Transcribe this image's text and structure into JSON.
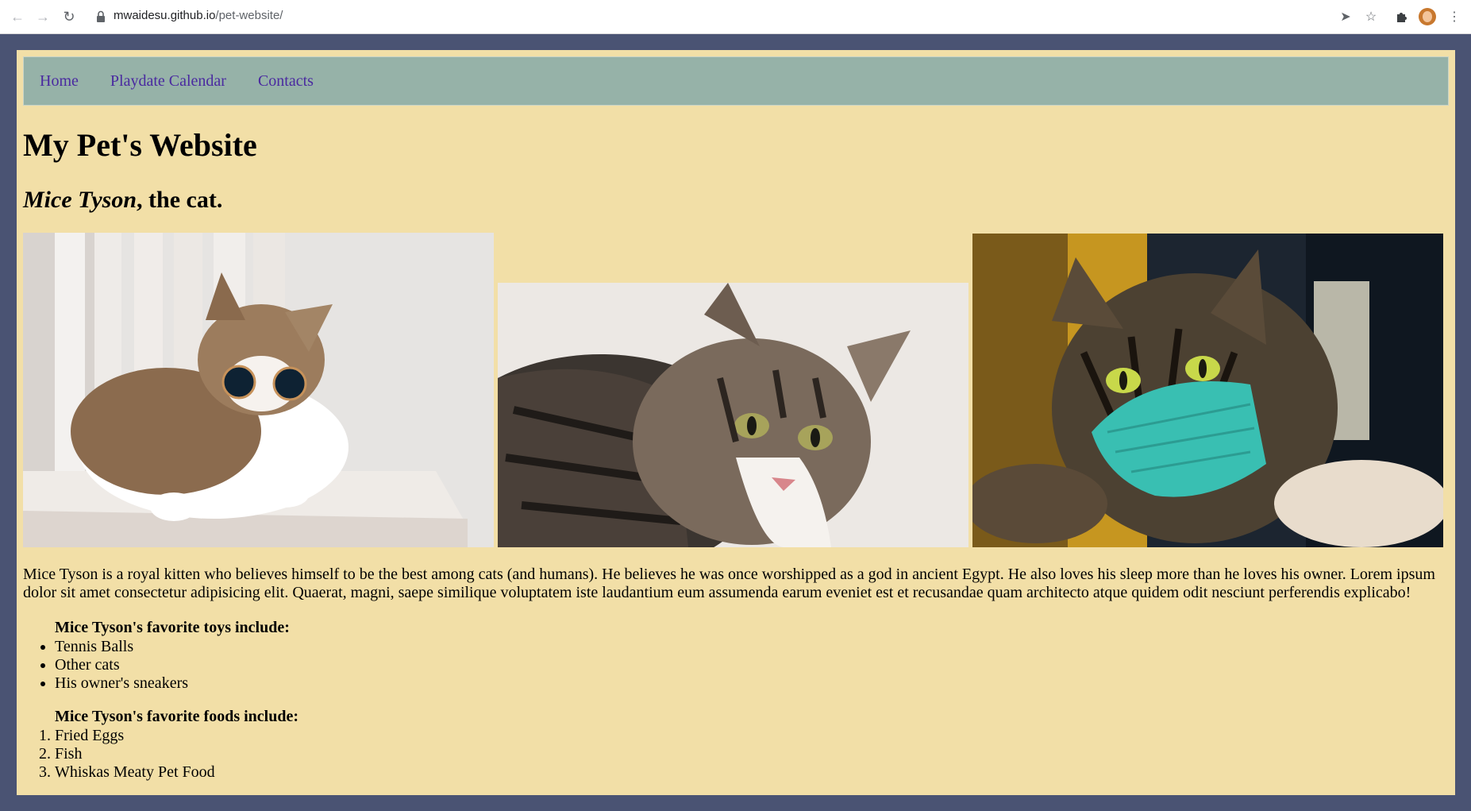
{
  "browser": {
    "url_host": "mwaidesu.github.io",
    "url_path": "/pet-website/"
  },
  "nav": {
    "items": [
      {
        "label": "Home"
      },
      {
        "label": "Playdate Calendar"
      },
      {
        "label": "Contacts"
      }
    ]
  },
  "page": {
    "title": "My Pet's Website",
    "subtitle_name": "Mice Tyson",
    "subtitle_rest": ", the cat.",
    "description": "Mice Tyson is a royal kitten who believes himself to be the best among cats (and humans). He believes he was once worshipped as a god in ancient Egypt. He also loves his sleep more than he loves his owner. Lorem ipsum dolor sit amet consectetur adipisicing elit. Quaerat, magni, saepe similique voluptatem iste laudantium eum assumenda earum eveniet est et recusandae quam architecto atque quidem odit nesciunt perferendis explicabo!"
  },
  "toys": {
    "title": "Mice Tyson's favorite toys include:",
    "items": [
      "Tennis Balls",
      "Other cats",
      "His owner's sneakers"
    ]
  },
  "foods": {
    "title": "Mice Tyson's favorite foods include:",
    "items": [
      "Fried Eggs",
      "Fish",
      "Whiskas Meaty Pet Food"
    ]
  },
  "colors": {
    "frame": "#4a5373",
    "page_bg": "#f2dfa7",
    "navbar_bg": "#96b2a8",
    "link": "#4a2aa0"
  }
}
